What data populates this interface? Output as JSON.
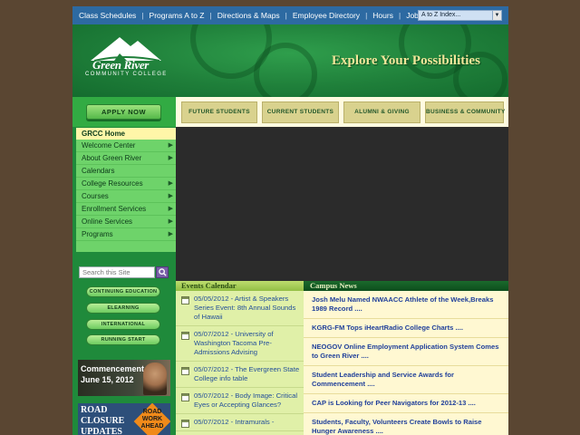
{
  "top_nav": {
    "links": [
      "Class Schedules",
      "Programs A to Z",
      "Directions & Maps",
      "Employee Directory",
      "Hours",
      "Jobs"
    ],
    "az_select": "A to Z Index..."
  },
  "banner": {
    "logo_name": "Green River",
    "logo_sub": "COMMUNITY COLLEGE",
    "tagline": "Explore Your Possibilities"
  },
  "apply_button": "APPLY NOW",
  "audience_tabs": [
    "FUTURE STUDENTS",
    "CURRENT STUDENTS",
    "ALUMNI & GIVING",
    "BUSINESS & COMMUNITY"
  ],
  "sidebar": {
    "home": "GRCC Home",
    "menu": [
      {
        "label": "Welcome Center",
        "has_submenu": true
      },
      {
        "label": "About Green River",
        "has_submenu": true
      },
      {
        "label": "Calendars",
        "has_submenu": false
      },
      {
        "label": "College Resources",
        "has_submenu": true
      },
      {
        "label": "Courses",
        "has_submenu": true
      },
      {
        "label": "Enrollment Services",
        "has_submenu": true
      },
      {
        "label": "Online Services",
        "has_submenu": true
      },
      {
        "label": "Programs",
        "has_submenu": true
      }
    ],
    "search_placeholder": "Search this Site",
    "quick_links": [
      "CONTINUING EDUCATION",
      "ELEARNING",
      "INTERNATIONAL",
      "RUNNING START"
    ],
    "promo_commencement": {
      "line1": "Commencement",
      "line2": "June 15, 2012"
    },
    "promo_road": {
      "line1": "ROAD",
      "line2": "CLOSURE",
      "line3": "UPDATES",
      "sign": "ROAD WORK AHEAD"
    }
  },
  "events": {
    "title": "Events Calendar",
    "items": [
      "05/05/2012 - Artist & Speakers Series Event: 8th Annual Sounds of Hawaii",
      "05/07/2012 - University of Washington Tacoma Pre-Admissions Advising",
      "05/07/2012 - The Evergreen State College info table",
      "05/07/2012 - Body Image: Critical Eyes or Accepting Glances?",
      "05/07/2012 - Intramurals -"
    ]
  },
  "news": {
    "title": "Campus News",
    "items": [
      "Josh Melu Named NWAACC Athlete of the Week,Breaks 1989 Record ....",
      "KGRG-FM Tops iHeartRadio College Charts ....",
      "NEOGOV Online Employment Application System Comes to Green River ....",
      "Student Leadership and Service Awards for Commencement ....",
      "CAP is Looking for Peer Navigators for 2012-13 ....",
      "Students, Faculty, Volunteers Create Bowls to Raise Hunger Awareness ...."
    ]
  },
  "colors": {
    "nav_blue": "#2d6aa2",
    "brand_green": "#1b7f3c",
    "tagline_gold": "#f1e69a",
    "menu_green": "#6ed36a",
    "link_blue": "#1f3f9a"
  }
}
